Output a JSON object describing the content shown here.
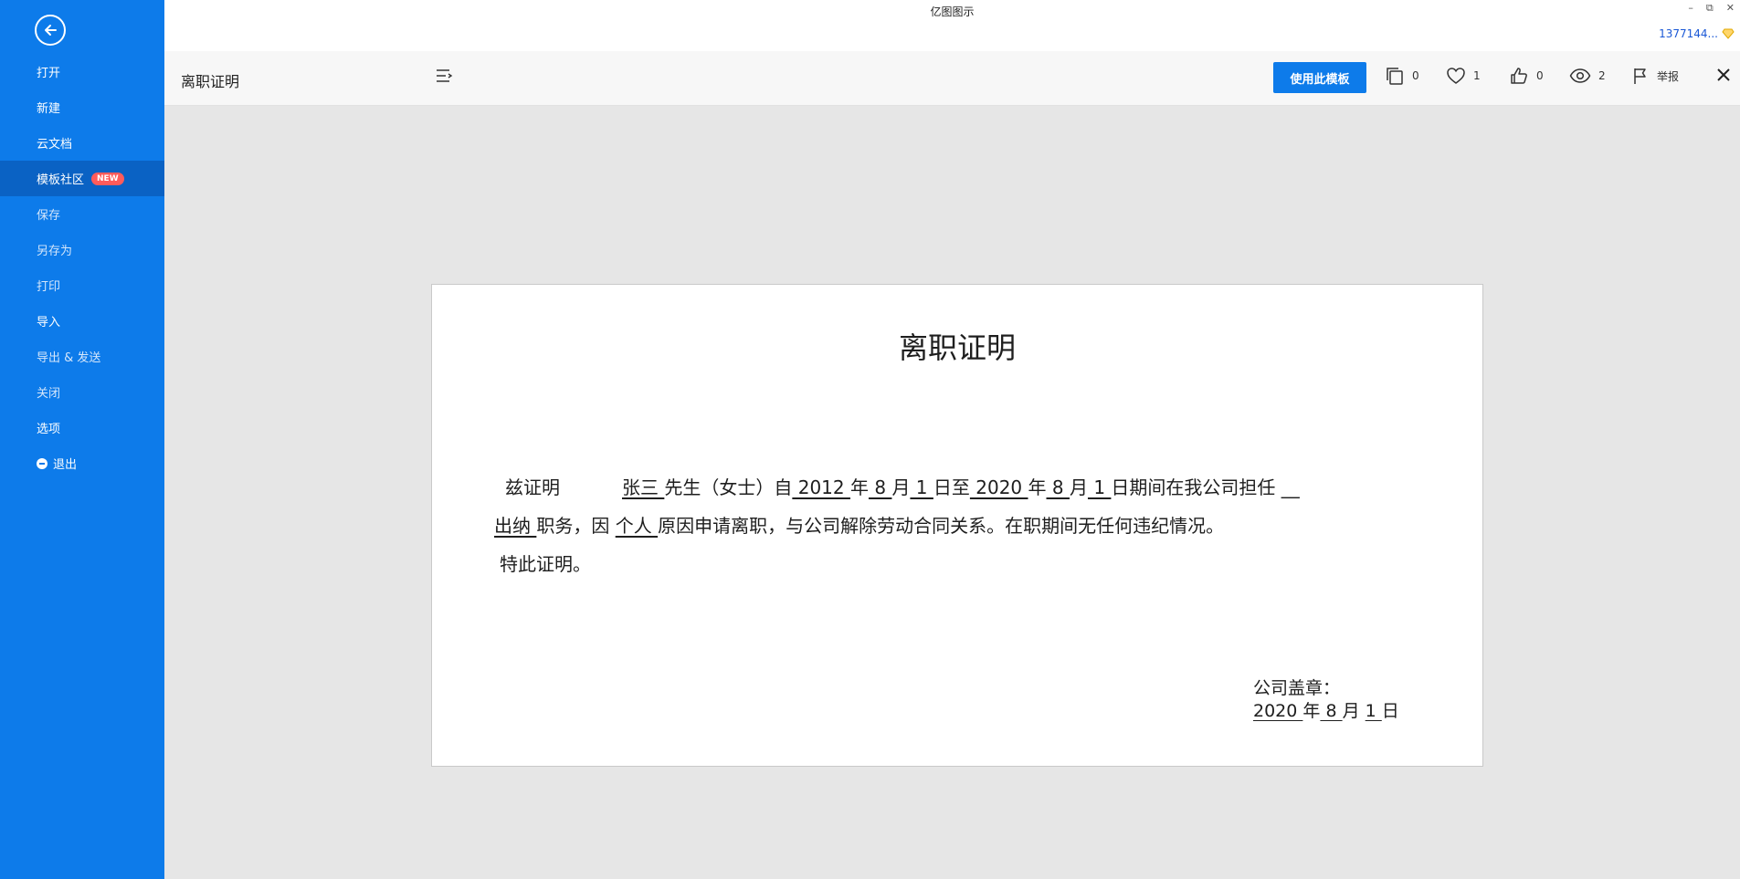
{
  "app": {
    "title": "亿图图示"
  },
  "user": {
    "name": "1377144..."
  },
  "window_controls": {
    "minimize": "–",
    "restore": "⧉",
    "close": "✕"
  },
  "sidebar": {
    "items": [
      {
        "label": "打开"
      },
      {
        "label": "新建"
      },
      {
        "label": "云文档"
      },
      {
        "label": "模板社区",
        "badge": "NEW"
      },
      {
        "label": "保存"
      },
      {
        "label": "另存为"
      },
      {
        "label": "打印"
      },
      {
        "label": "导入"
      },
      {
        "label": "导出 & 发送"
      },
      {
        "label": "关闭"
      },
      {
        "label": "选项"
      },
      {
        "label": "退出"
      }
    ]
  },
  "toolbar": {
    "doc_name": "离职证明",
    "use_template_label": "使用此模板",
    "copies_count": "0",
    "likes_count": "1",
    "thumbs_count": "0",
    "views_count": "2",
    "report_label": "举报"
  },
  "document": {
    "title": "离职证明",
    "line1": {
      "intro": "兹证明",
      "name": "张三 ",
      "gender": "先生（女士）自",
      "start_year": " 2012 ",
      "y1": "年",
      "start_month": " 8  ",
      "m1": "月",
      "start_day": " 1  ",
      "until": " 日至",
      "end_year": " 2020 ",
      "y2": "年",
      "end_month": "  8  ",
      "m2": "月",
      "end_day": " 1  ",
      "tail": "日期间在我公司担任",
      "blank": " __"
    },
    "line2": {
      "position": "出纳  ",
      "duty": "职务，因",
      "reason": "  个人  ",
      "rest": "原因申请离职，与公司解除劳动合同关系。在职期间无任何违纪情况。"
    },
    "line3": "特此证明。",
    "seal": {
      "label": "公司盖章：",
      "year": " 2020 ",
      "y": "年",
      "month": " 8 ",
      "m": "月",
      "day": "  1  ",
      "d": "日"
    }
  },
  "colors": {
    "sidebar": "#0d7bea",
    "sidebar_active": "#0a62c4",
    "badge": "#ff5b5b",
    "canvas": "#e6e6e6",
    "toolbar": "#f7f7f7"
  }
}
